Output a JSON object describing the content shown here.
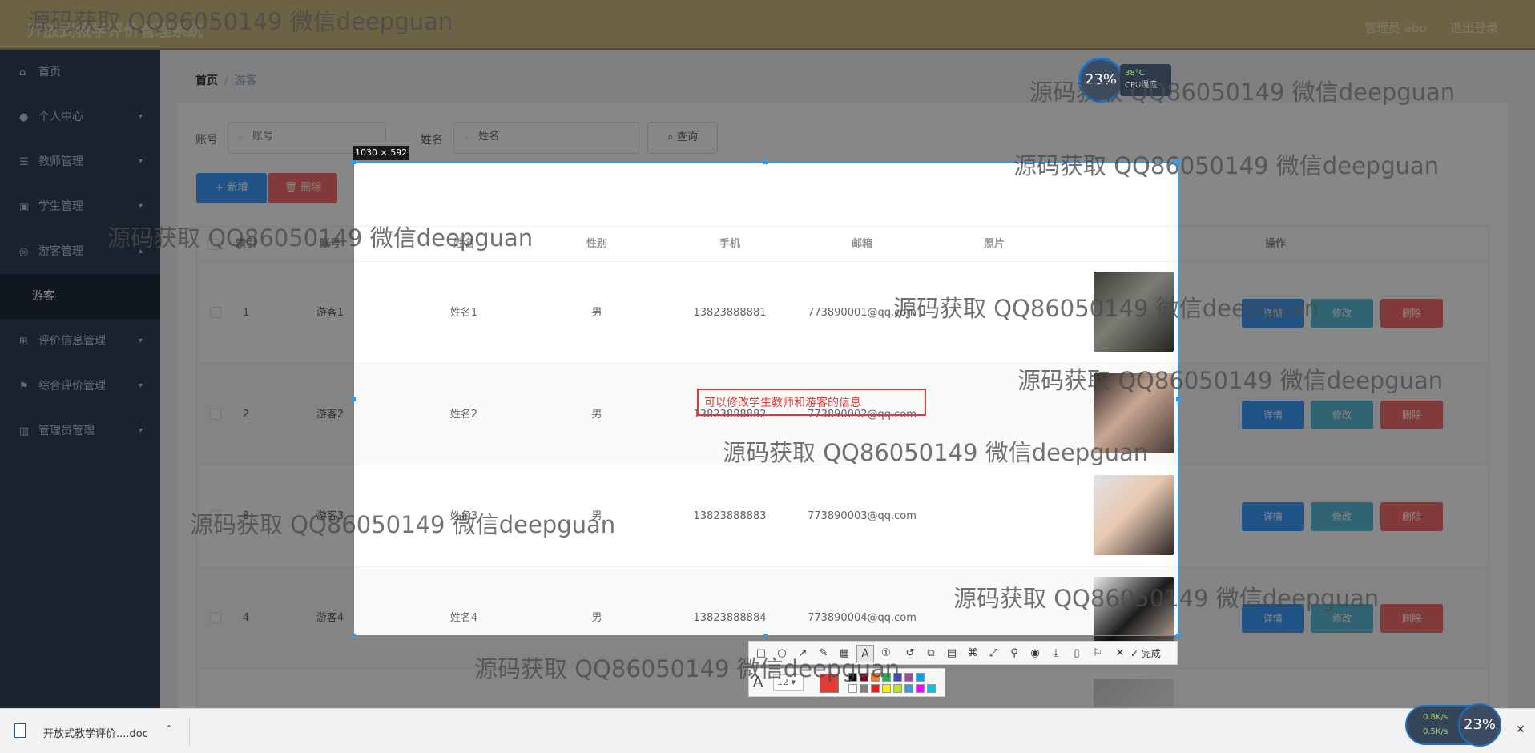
{
  "header": {
    "title": "开放式教学评价管理系统",
    "admin": "管理员 abo",
    "logout": "退出登录"
  },
  "sidebar": {
    "items": [
      {
        "label": "首页",
        "icon": "home-icon"
      },
      {
        "label": "个人中心",
        "icon": "user-icon"
      },
      {
        "label": "教师管理",
        "icon": "list-icon"
      },
      {
        "label": "学生管理",
        "icon": "ticket-icon"
      },
      {
        "label": "游客管理",
        "icon": "compass-icon"
      },
      {
        "label": "游客",
        "icon": ""
      },
      {
        "label": "评价信息管理",
        "icon": "grid-icon"
      },
      {
        "label": "综合评价管理",
        "icon": "flag-icon"
      },
      {
        "label": "管理员管理",
        "icon": "chart-icon"
      }
    ]
  },
  "breadcrumb": {
    "home": "首页",
    "sep": "/",
    "current": "游客"
  },
  "search": {
    "account_label": "账号",
    "account_placeholder": "账号",
    "name_label": "姓名",
    "name_placeholder": "姓名",
    "query_button": "查询"
  },
  "actions": {
    "add": "新增",
    "delete": "删除"
  },
  "table": {
    "headers": [
      "账号",
      "姓名",
      "性别",
      "手机",
      "邮箱",
      "照片",
      "操作"
    ],
    "index_header": "索引",
    "rows": [
      {
        "index": "1",
        "account": "游客1",
        "name": "姓名1",
        "gender": "男",
        "phone": "13823888881",
        "email": "773890001@qq.com"
      },
      {
        "index": "2",
        "account": "游客2",
        "name": "姓名2",
        "gender": "男",
        "phone": "13823888882",
        "email": "773890002@qq.com"
      },
      {
        "index": "3",
        "account": "游客3",
        "name": "姓名3",
        "gender": "男",
        "phone": "13823888883",
        "email": "773890003@qq.com"
      },
      {
        "index": "4",
        "account": "游客4",
        "name": "姓名4",
        "gender": "男",
        "phone": "13823888884",
        "email": "773890004@qq.com"
      }
    ],
    "row_buttons": {
      "detail": "详情",
      "edit": "修改",
      "delete": "删除"
    }
  },
  "screenshot_tool": {
    "size_label": "1030 × 592",
    "annotation_text": "可以修改学生教师和游客的信息",
    "done_label": "完成",
    "font_size": "12",
    "colors": [
      "#000000",
      "#880015",
      "#ff7f27",
      "#22b14c",
      "#3f48cc",
      "#a349a4",
      "#00a2e8",
      "#ffffff",
      "#7f7f7f",
      "#ed1c24",
      "#fff200",
      "#b5e61d",
      "#3a9bd9",
      "#ff00ff",
      "#00c5d4"
    ],
    "active_color": "#e53935"
  },
  "watermark": "源码获取 QQ86050149 微信deepguan",
  "system": {
    "cpu_percent": "23%",
    "cpu_temp": "38°C",
    "cpu_status": "CPU温度",
    "net_up": "0.8K/s",
    "net_down": "0.5K/s",
    "net_percent": "23%"
  },
  "taskbar": {
    "download_name": "开放式教学评价....doc"
  }
}
